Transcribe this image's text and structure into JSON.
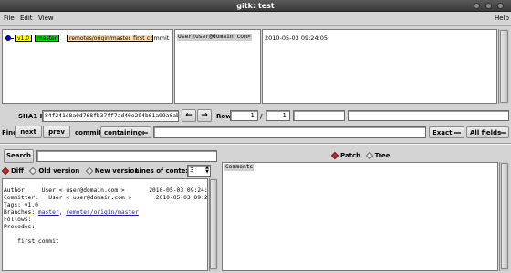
{
  "window": {
    "title": "gitk: test"
  },
  "menu": {
    "file": "File",
    "edit": "Edit",
    "view": "View",
    "help": "Help"
  },
  "graph": {
    "tags": {
      "version": "v1.0",
      "branch_local": "master",
      "branch_remote": "remotes/origin/master"
    },
    "commit_subject": "first commit",
    "author_col": "User<user@domain.com>",
    "date_col": "2010-05-03 09:24:05"
  },
  "sha": {
    "label": "SHA1 ID:",
    "value": "84f241e8a0d768fb37ff7ad40e294b61a99a0abe",
    "row_label": "Row",
    "row_current": "1",
    "row_sep": "/",
    "row_total": "1"
  },
  "find": {
    "label": "Find",
    "next": "next",
    "prev": "prev",
    "commit": "commit",
    "containing": "containing:",
    "exact": "Exact",
    "fields": "All fields"
  },
  "search": {
    "button": "Search"
  },
  "diffopts": {
    "diff": "Diff",
    "old": "Old version",
    "new": "New version",
    "context_label": "Lines of context:",
    "context_value": "3"
  },
  "viewmode": {
    "patch": "Patch",
    "tree": "Tree"
  },
  "details": {
    "author": "Author:    User < user@domain.com >       2010-05-03 09:24:0",
    "committer": "Committer:   User < user@domain.com >       2010-05-03 09:2",
    "tags": "Tags: v1.0",
    "branches_label": "Branches: ",
    "branch1": "master",
    "branch_sep": ", ",
    "branch2": "remotes/origin/master",
    "follows": "Follows:",
    "precedes": "Precedes:",
    "message": "    first commit"
  },
  "files": {
    "comments": "Comments"
  },
  "colors": {
    "local_branch": "#00e000",
    "tag": "#ffff00",
    "remote": "#ffddaa",
    "graph_dot": "#0000ff"
  }
}
